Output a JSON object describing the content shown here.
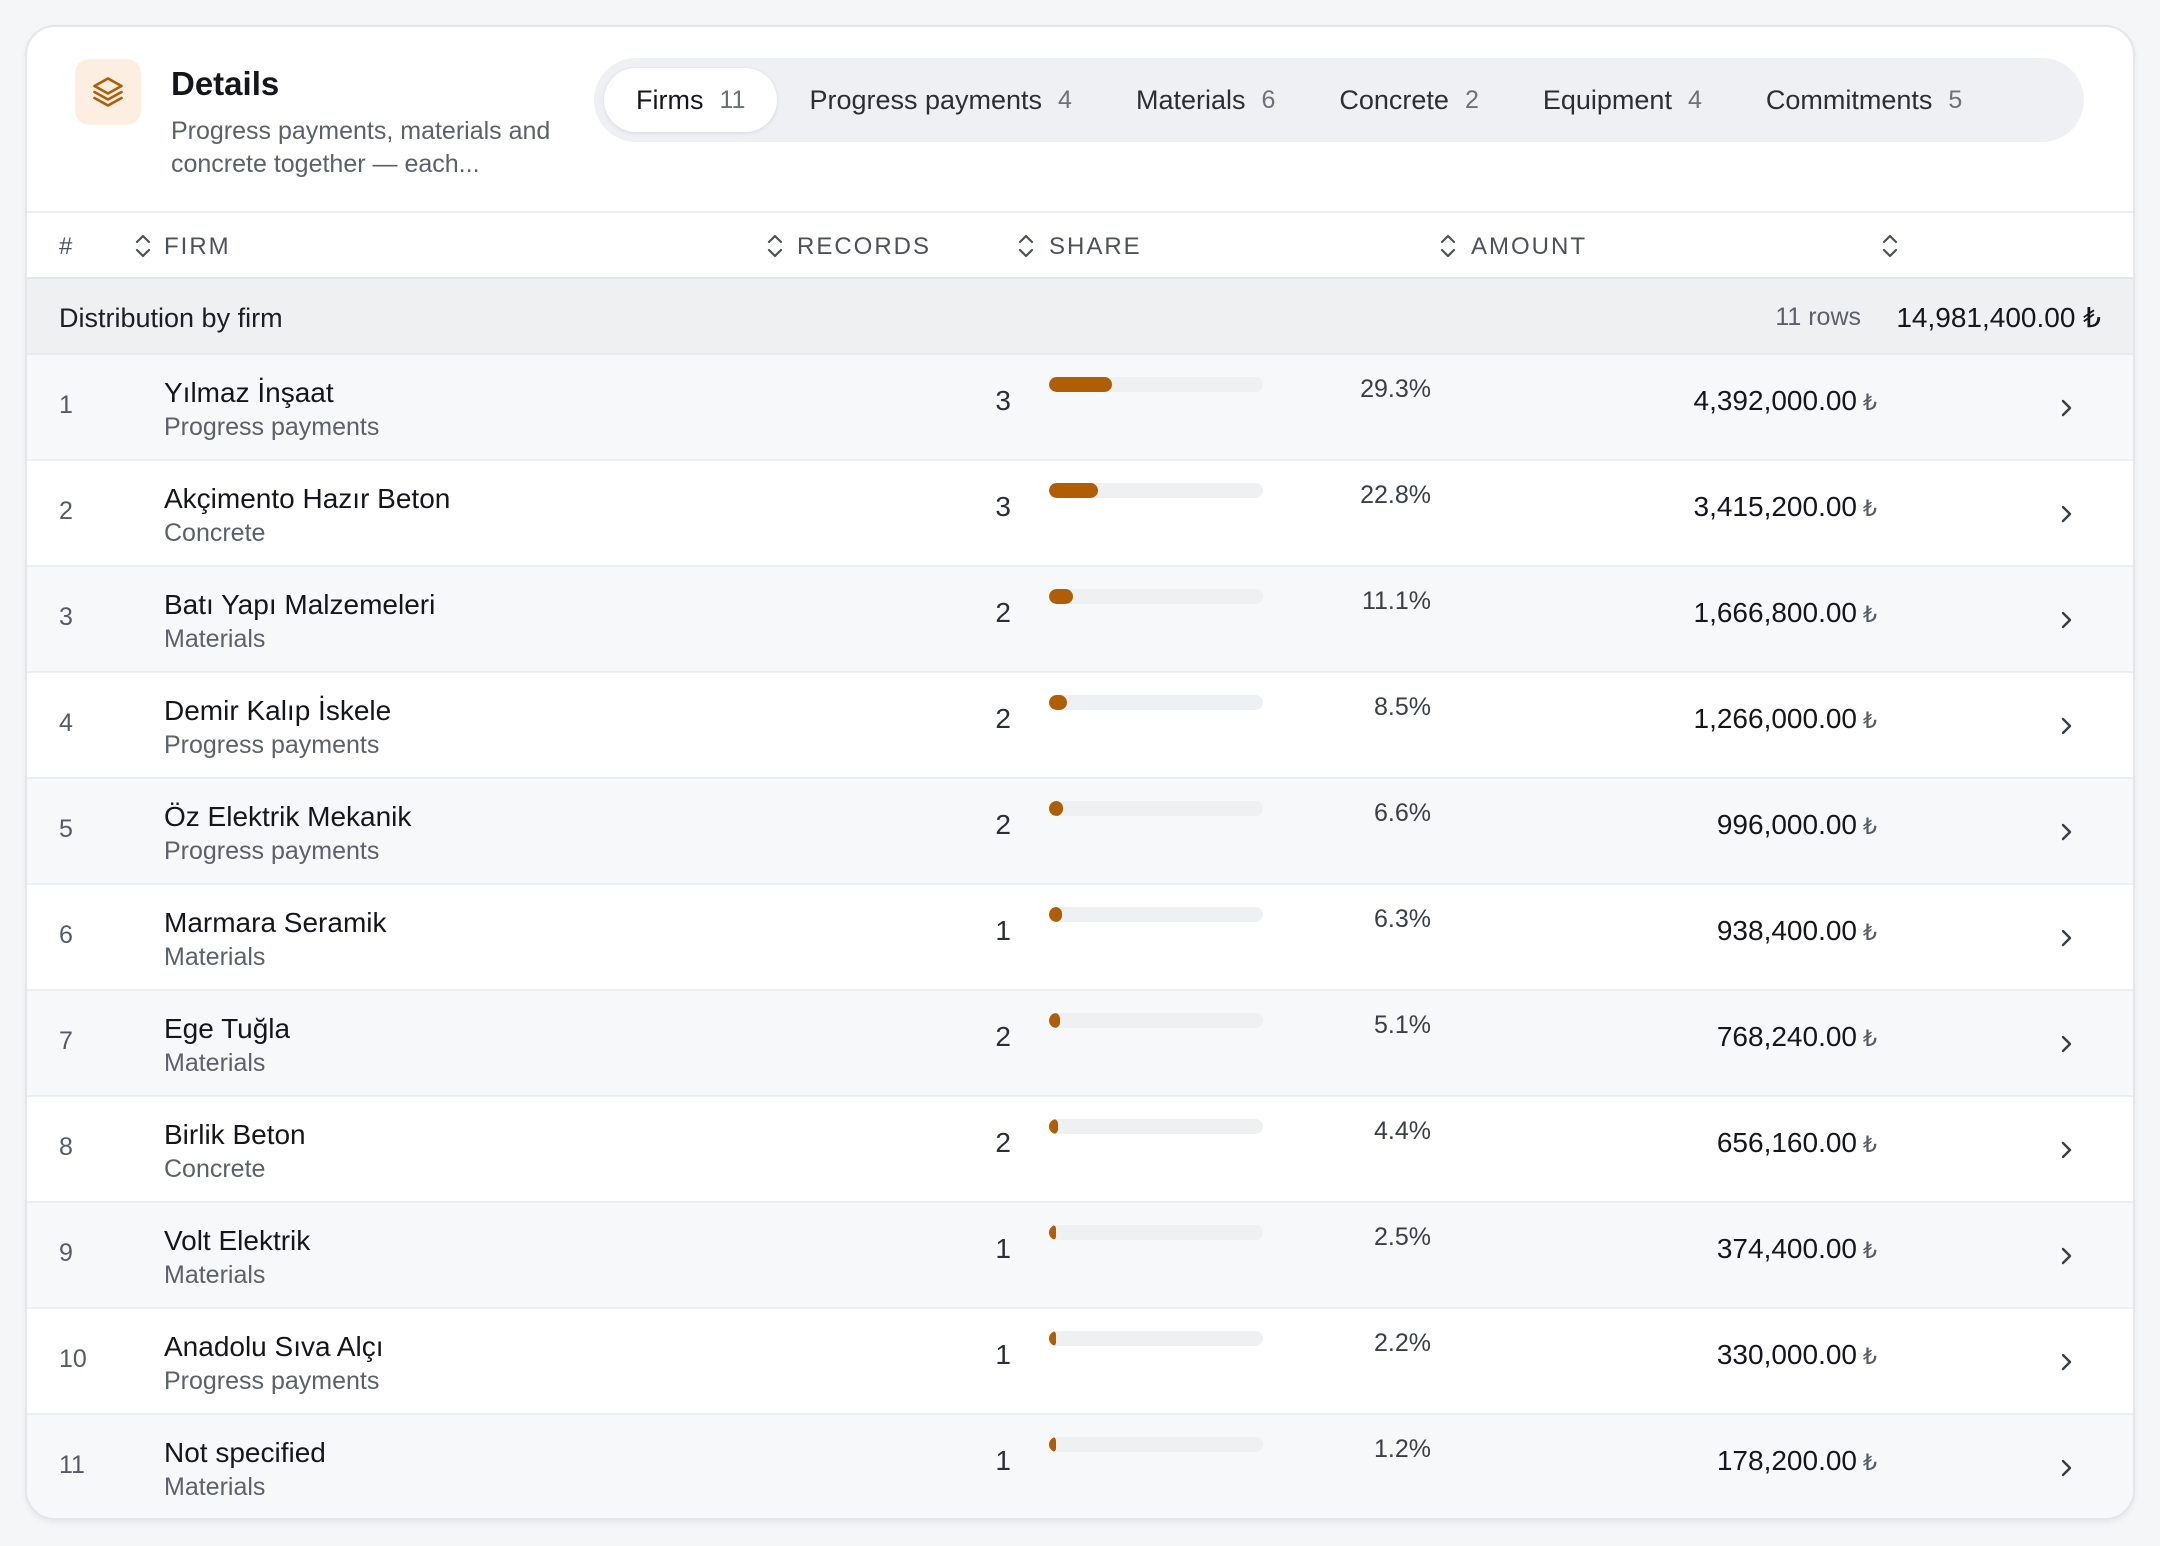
{
  "header": {
    "title": "Details",
    "subtitle": "Progress payments, materials and concrete together — each..."
  },
  "tabs": [
    {
      "label": "Firms",
      "count": "11",
      "active": true
    },
    {
      "label": "Progress payments",
      "count": "4"
    },
    {
      "label": "Materials",
      "count": "6"
    },
    {
      "label": "Concrete",
      "count": "2"
    },
    {
      "label": "Equipment",
      "count": "4"
    },
    {
      "label": "Commitments",
      "count": "5"
    }
  ],
  "columns": {
    "index": "#",
    "firm": "FIRM",
    "records": "RECORDS",
    "share": "SHARE",
    "amount": "AMOUNT"
  },
  "group": {
    "label": "Distribution by firm",
    "rows": "11 rows",
    "total": "14,981,400.00 ₺"
  },
  "currency_symbol": "₺",
  "accent_color": "#b05e06",
  "rows": [
    {
      "index": "1",
      "firm": "Yılmaz İnşaat",
      "type": "Progress payments",
      "records": "3",
      "share": 29.3,
      "share_label": "29.3%",
      "amount": "4,392,000.00"
    },
    {
      "index": "2",
      "firm": "Akçimento Hazır Beton",
      "type": "Concrete",
      "records": "3",
      "share": 22.8,
      "share_label": "22.8%",
      "amount": "3,415,200.00"
    },
    {
      "index": "3",
      "firm": "Batı Yapı Malzemeleri",
      "type": "Materials",
      "records": "2",
      "share": 11.1,
      "share_label": "11.1%",
      "amount": "1,666,800.00"
    },
    {
      "index": "4",
      "firm": "Demir Kalıp İskele",
      "type": "Progress payments",
      "records": "2",
      "share": 8.5,
      "share_label": "8.5%",
      "amount": "1,266,000.00"
    },
    {
      "index": "5",
      "firm": "Öz Elektrik Mekanik",
      "type": "Progress payments",
      "records": "2",
      "share": 6.6,
      "share_label": "6.6%",
      "amount": "996,000.00"
    },
    {
      "index": "6",
      "firm": "Marmara Seramik",
      "type": "Materials",
      "records": "1",
      "share": 6.3,
      "share_label": "6.3%",
      "amount": "938,400.00"
    },
    {
      "index": "7",
      "firm": "Ege Tuğla",
      "type": "Materials",
      "records": "2",
      "share": 5.1,
      "share_label": "5.1%",
      "amount": "768,240.00"
    },
    {
      "index": "8",
      "firm": "Birlik Beton",
      "type": "Concrete",
      "records": "2",
      "share": 4.4,
      "share_label": "4.4%",
      "amount": "656,160.00"
    },
    {
      "index": "9",
      "firm": "Volt Elektrik",
      "type": "Materials",
      "records": "1",
      "share": 2.5,
      "share_label": "2.5%",
      "amount": "374,400.00"
    },
    {
      "index": "10",
      "firm": "Anadolu Sıva Alçı",
      "type": "Progress payments",
      "records": "1",
      "share": 2.2,
      "share_label": "2.2%",
      "amount": "330,000.00"
    },
    {
      "index": "11",
      "firm": "Not specified",
      "type": "Materials",
      "records": "1",
      "share": 1.2,
      "share_label": "1.2%",
      "amount": "178,200.00"
    }
  ]
}
